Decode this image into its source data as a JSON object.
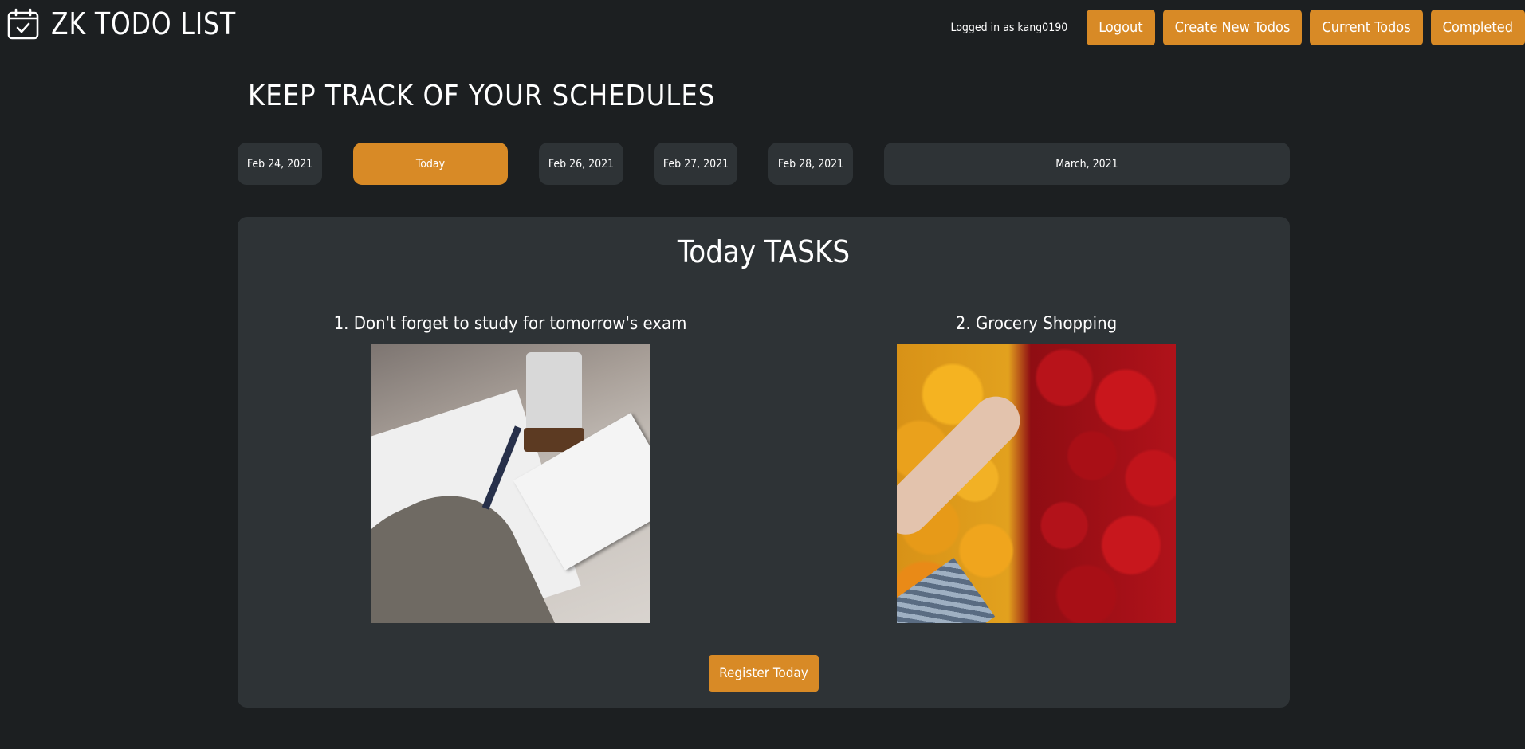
{
  "header": {
    "brand_title": "ZK TODO LIST",
    "brand_icon": "calendar-check-icon",
    "login_text": "Logged in as kang0190",
    "nav": {
      "logout": "Logout",
      "create": "Create New Todos",
      "current": "Current Todos",
      "completed": "Completed"
    }
  },
  "headline": "KEEP TRACK OF YOUR SCHEDULES",
  "date_tabs": [
    {
      "label": "Feb 24, 2021",
      "active": false
    },
    {
      "label": "Today",
      "active": true
    },
    {
      "label": "Feb 26, 2021",
      "active": false
    },
    {
      "label": "Feb 27, 2021",
      "active": false
    },
    {
      "label": "Feb 28, 2021",
      "active": false
    },
    {
      "label": "March, 2021",
      "active": false
    }
  ],
  "panel": {
    "title": "Today TASKS",
    "tasks": [
      {
        "title": "1. Don't forget to study for tomorrow's exam",
        "image": "studying-photo"
      },
      {
        "title": "2. Grocery Shopping",
        "image": "bell-peppers-photo"
      }
    ],
    "register_label": "Register Today"
  },
  "colors": {
    "background": "#1c1f21",
    "panel": "#2e3336",
    "accent": "#d88a26"
  }
}
